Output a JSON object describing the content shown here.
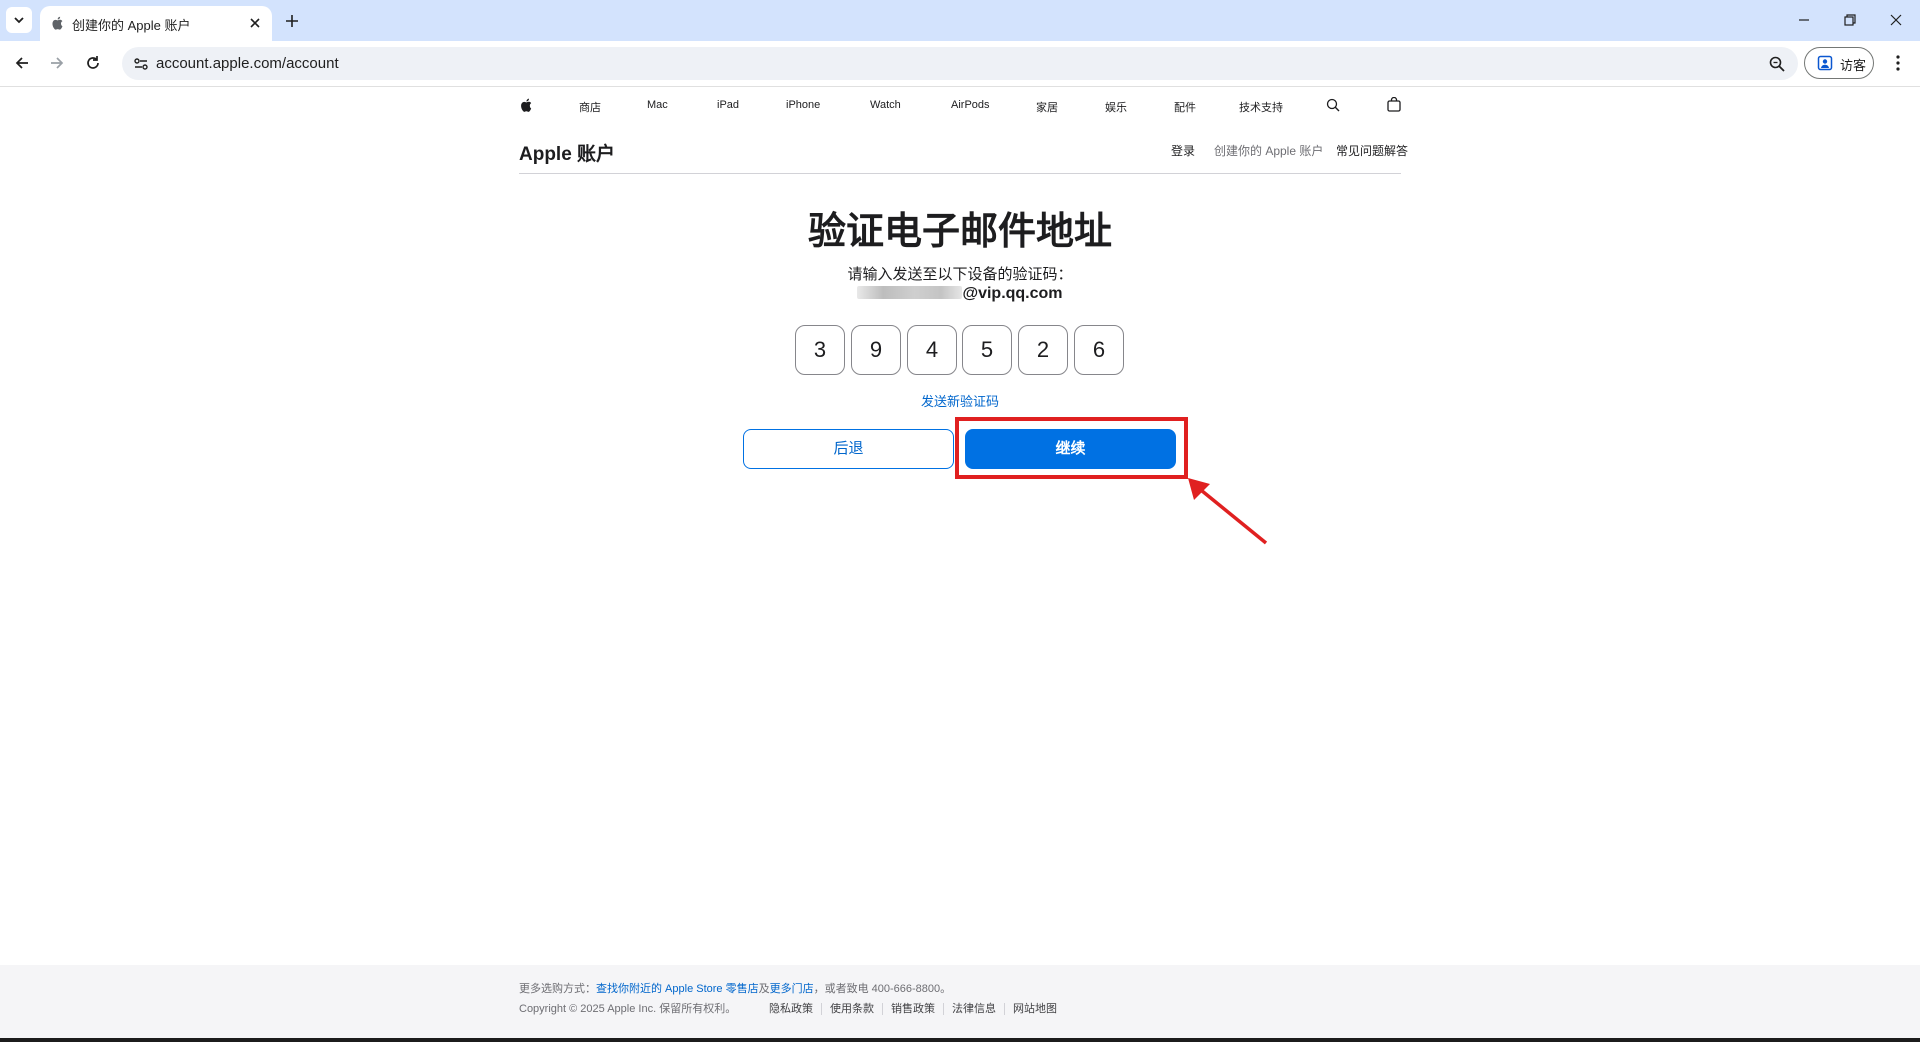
{
  "browser": {
    "tab_title": "创建你的 Apple 账户",
    "url": "account.apple.com/account",
    "guest_label": "访客"
  },
  "gnav": {
    "items": [
      "商店",
      "Mac",
      "iPad",
      "iPhone",
      "Watch",
      "AirPods",
      "家居",
      "娱乐",
      "配件",
      "技术支持"
    ]
  },
  "localnav": {
    "title": "Apple 账户",
    "links": [
      "登录",
      "创建你的 Apple 账户",
      "常见问题解答"
    ]
  },
  "main": {
    "heading": "验证电子邮件地址",
    "subtitle": "请输入发送至以下设备的验证码：",
    "email_suffix": "@vip.qq.com",
    "code": [
      "3",
      "9",
      "4",
      "5",
      "2",
      "6"
    ],
    "resend": "发送新验证码",
    "back_button": "后退",
    "continue_button": "继续"
  },
  "annotation": {
    "color": "#e02020"
  },
  "footer": {
    "more_ways_prefix": "更多选购方式：",
    "find_store_link": "查找你附近的 Apple Store 零售店",
    "and": "及",
    "more_stores_link": "更多门店",
    "call_suffix": "，或者致电 400-666-8800。",
    "copyright": "Copyright © 2025 Apple Inc. 保留所有权利。",
    "links": [
      "隐私政策",
      "使用条款",
      "销售政策",
      "法律信息",
      "网站地图"
    ]
  }
}
